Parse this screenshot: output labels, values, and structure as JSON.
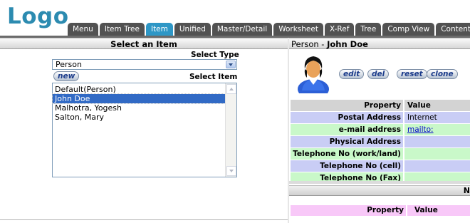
{
  "logo": "Logo",
  "tabs": [
    {
      "label": "Menu",
      "active": false
    },
    {
      "label": "Item Tree",
      "active": false
    },
    {
      "label": "Item",
      "active": true
    },
    {
      "label": "Unified",
      "active": false
    },
    {
      "label": "Master/Detail",
      "active": false
    },
    {
      "label": "Worksheet",
      "active": false
    },
    {
      "label": "X-Ref",
      "active": false
    },
    {
      "label": "Tree",
      "active": false
    },
    {
      "label": "Comp View",
      "active": false
    },
    {
      "label": "Content",
      "active": false
    }
  ],
  "left": {
    "title": "Select an Item",
    "select_type_label": "Select Type",
    "type_value": "Person",
    "new_button": "new",
    "select_item_label": "Select Item",
    "items": [
      "Default(Person)",
      "John Doe",
      "Malhotra, Yogesh",
      "Salton, Mary"
    ],
    "selected_index": 1
  },
  "right": {
    "title_type": "Person - ",
    "title_name": "John Doe",
    "buttons": {
      "edit": "edit",
      "del": "del",
      "reset": "reset",
      "clone": "clone"
    },
    "header": {
      "property": "Property",
      "value": "Value"
    },
    "rows": [
      {
        "property": "Postal Address",
        "value": "Internet",
        "color": "blue"
      },
      {
        "property": "e-mail address",
        "value": "mailto:",
        "color": "green",
        "link": true
      },
      {
        "property": "Physical Address",
        "value": "",
        "color": "blue"
      },
      {
        "property": "Telephone No (work/land)",
        "value": "",
        "color": "green"
      },
      {
        "property": "Telephone No (cell)",
        "value": "",
        "color": "blue"
      },
      {
        "property": "Telephone No (Fax)",
        "value": "",
        "color": "green"
      }
    ],
    "section2_label": "N",
    "section2_header": {
      "property": "Property",
      "value": "Value"
    }
  },
  "colors": {
    "logo": "#2c8bb0",
    "tab": "#525252",
    "tab_active": "#2e97c6",
    "row_blue": "#c9cdf5",
    "row_green": "#c9f8c9",
    "row_pink": "#f8c8f8"
  }
}
